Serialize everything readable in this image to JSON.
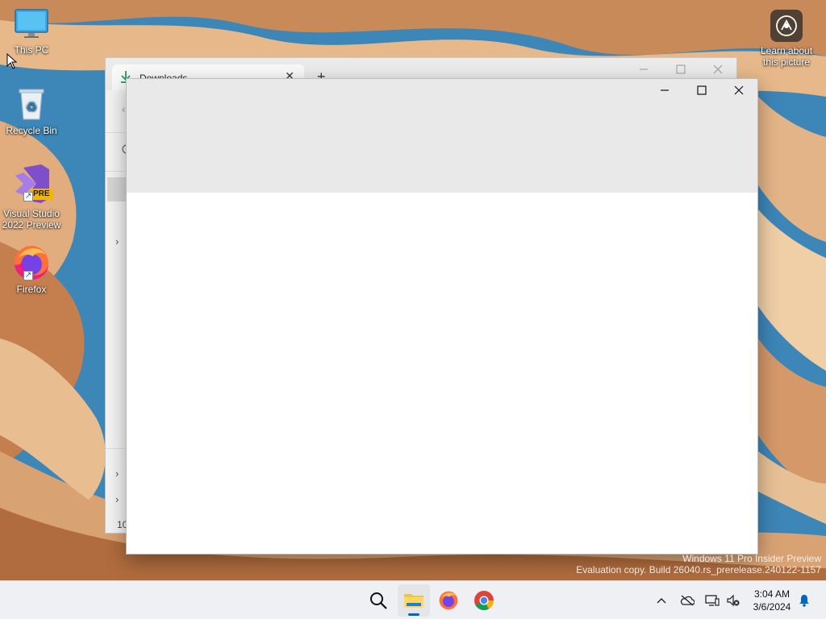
{
  "desktop": {
    "icons": [
      {
        "label": "This PC",
        "icon": "monitor-icon"
      },
      {
        "label": "Recycle Bin",
        "icon": "recycle-bin-icon"
      },
      {
        "label": "Visual Studio 2022 Preview",
        "icon": "visual-studio-icon",
        "badge": "PRE"
      },
      {
        "label": "Firefox",
        "icon": "firefox-icon"
      }
    ],
    "learn_about_picture": "Learn about this picture"
  },
  "explorer_window": {
    "tab_label": "Downloads",
    "tab_close": "✕",
    "new_tab": "+",
    "status_text": "10"
  },
  "blank_window": {},
  "watermark": {
    "line1": "Windows 11 Pro Insider Preview",
    "line2": "Evaluation copy. Build 26040.rs_prerelease.240122-1157"
  },
  "taskbar": {
    "apps": [
      "search-icon",
      "file-explorer-icon",
      "firefox-icon",
      "chrome-icon"
    ],
    "tray": [
      "chevron-up-icon",
      "onedrive-icon",
      "network-icon",
      "volume-icon",
      "notification-bell-icon"
    ],
    "time": "3:04 AM",
    "date": "3/6/2024"
  },
  "colors": {
    "accent": "#0067c0",
    "taskbar": "#eef0f3",
    "window_header": "#e9e9e9"
  }
}
